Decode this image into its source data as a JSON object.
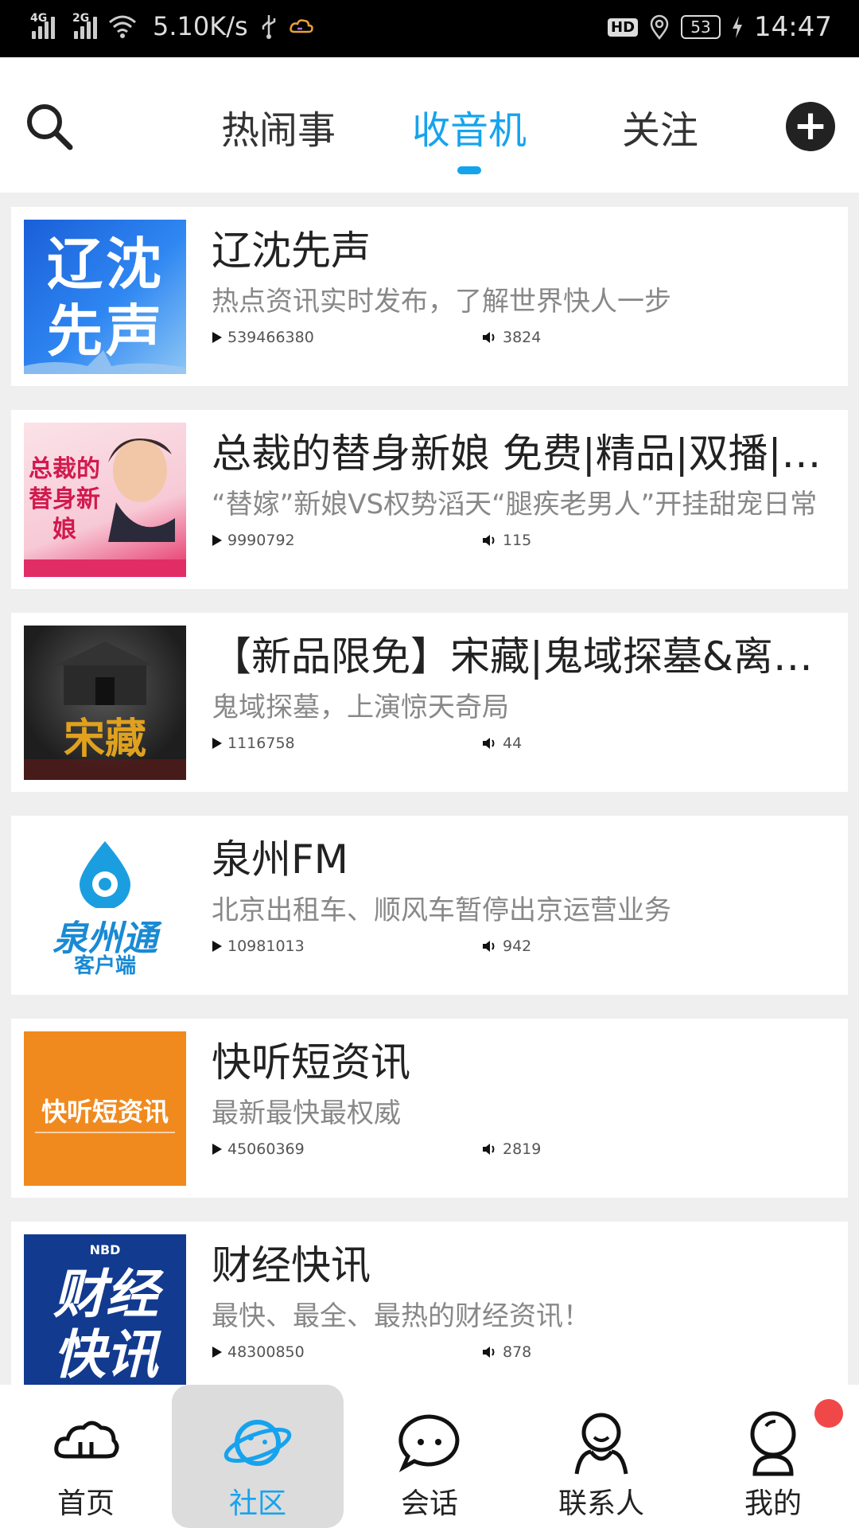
{
  "status_bar": {
    "net1": "4G",
    "net2": "2G",
    "speed": "5.10K/s",
    "hd": "HD",
    "battery": "53",
    "time": "14:47"
  },
  "header": {
    "tabs": [
      {
        "label": "热闹事"
      },
      {
        "label": "收音机"
      },
      {
        "label": "关注"
      }
    ],
    "active_tab": "收音机",
    "plus": "+"
  },
  "stations": [
    {
      "title": "辽沈先声",
      "desc": "热点资讯实时发布，了解世界快人一步",
      "plays": "539466380",
      "listeners": "3824",
      "cover_text": "辽沈先声"
    },
    {
      "title": "总裁的替身新娘 免费|精品|双播|…",
      "desc": "“替嫁”新娘VS权势滔天“腿疾老男人”开挂甜宠日常",
      "plays": "9990792",
      "listeners": "115",
      "cover_text": "总裁的替身新娘"
    },
    {
      "title": "【新品限免】宋藏|鬼域探墓&离…",
      "desc": "鬼域探墓，上演惊天奇局",
      "plays": "1116758",
      "listeners": "44",
      "cover_text": "宋藏"
    },
    {
      "title": "泉州FM",
      "desc": "北京出租车、顺风车暂停出京运营业务",
      "plays": "10981013",
      "listeners": "942",
      "cover_text": "泉州通",
      "cover_sub": "客户端"
    },
    {
      "title": "快听短资讯",
      "desc": "最新最快最权威",
      "plays": "45060369",
      "listeners": "2819",
      "cover_text": "快听短资讯"
    },
    {
      "title": "财经快讯",
      "desc": "最快、最全、最热的财经资讯！",
      "plays": "48300850",
      "listeners": "878",
      "cover_text": "财经快讯",
      "cover_sub": "NBD"
    }
  ],
  "bottom_nav": [
    {
      "label": "首页"
    },
    {
      "label": "社区"
    },
    {
      "label": "会话"
    },
    {
      "label": "联系人"
    },
    {
      "label": "我的"
    }
  ],
  "colors": {
    "accent": "#16a3ee",
    "badge": "#f04848"
  }
}
